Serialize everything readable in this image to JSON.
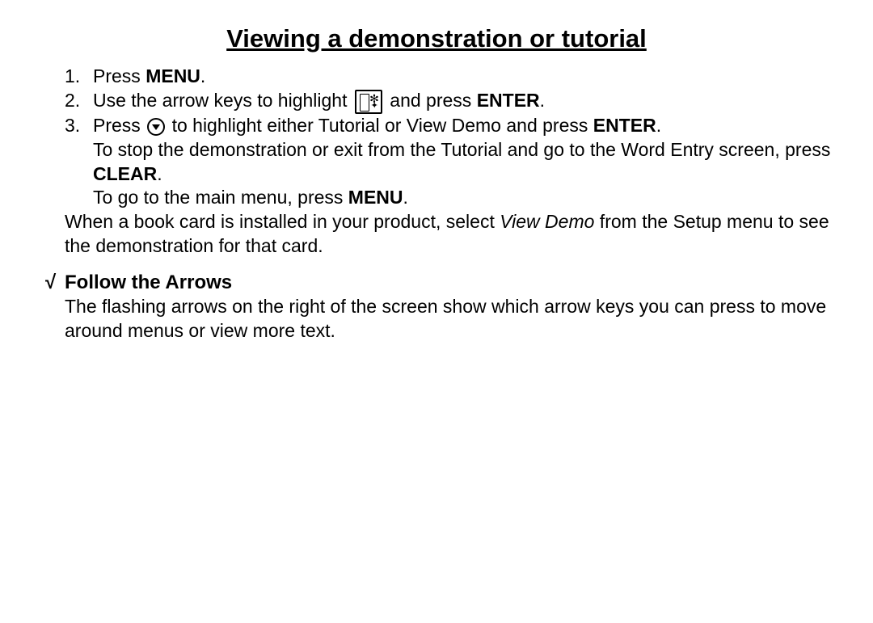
{
  "title": "Viewing a demonstration or tutorial",
  "steps": {
    "n1": "1.",
    "n2": "2.",
    "n3": "3.",
    "s1a": "Press ",
    "s1b": "MENU",
    "s1c": ".",
    "s2a": "Use the arrow keys to highlight ",
    "s2b": " and press ",
    "s2c": "ENTER",
    "s2d": ".",
    "s3a": "Press ",
    "s3b": " to highlight either Tutorial or View Demo and press ",
    "s3c": "ENTER",
    "s3d": ".",
    "s3e": "To stop the demonstration or exit from the Tutorial and go to the Word Entry screen,  press ",
    "s3f": "CLEAR",
    "s3g": ".",
    "s3h": "To go to the main menu, press ",
    "s3i": "MENU",
    "s3j": "."
  },
  "note": {
    "a": "When a book card is installed in your product, select ",
    "b": "View Demo",
    "c": " from the Setup menu to see the demonstration for that card."
  },
  "section": {
    "check": "√",
    "heading": "Follow the Arrows",
    "body": "The flashing arrows on the right of the screen show which arrow keys you can press to move around menus or view more text."
  }
}
